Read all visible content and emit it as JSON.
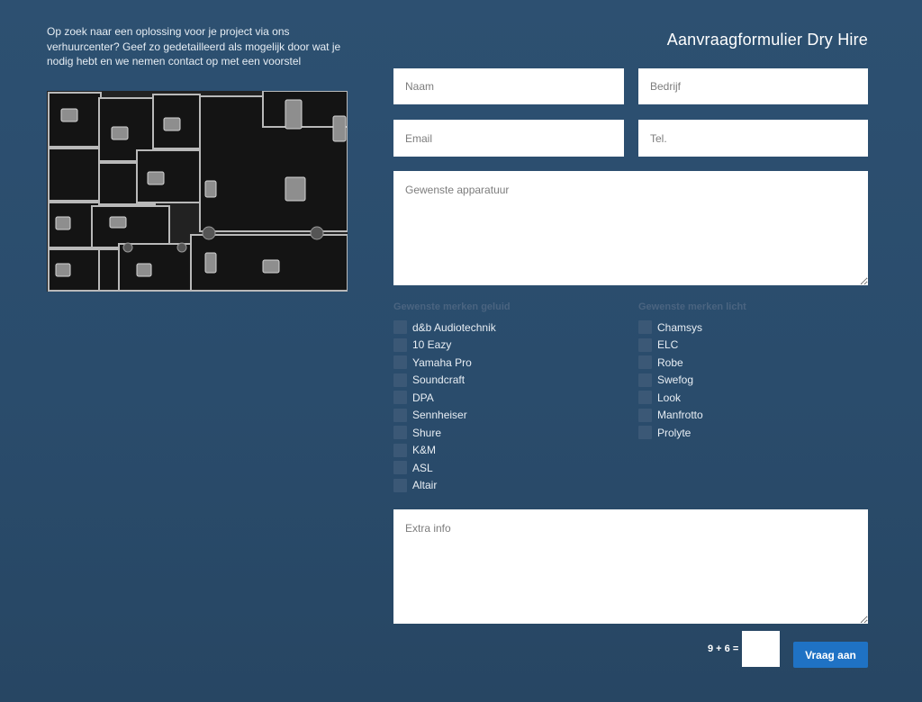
{
  "intro": {
    "text": "Op zoek naar een oplossing voor je project via ons verhuurcenter? Geef zo gedetailleerd als mogelijk door wat je nodig hebt en we nemen contact op met een voorstel"
  },
  "form": {
    "title": "Aanvraagformulier Dry Hire",
    "fields": {
      "naam": {
        "placeholder": "Naam",
        "value": ""
      },
      "bedrijf": {
        "placeholder": "Bedrijf",
        "value": ""
      },
      "email": {
        "placeholder": "Email",
        "value": ""
      },
      "tel": {
        "placeholder": "Tel.",
        "value": ""
      },
      "apparatuur": {
        "placeholder": "Gewenste apparatuur",
        "value": ""
      },
      "extra": {
        "placeholder": "Extra info",
        "value": ""
      }
    },
    "sound": {
      "title": "Gewenste merken geluid",
      "items": [
        "d&b Audiotechnik",
        "10 Eazy",
        "Yamaha Pro",
        "Soundcraft",
        "DPA",
        "Sennheiser",
        "Shure",
        "K&M",
        "ASL",
        "Altair"
      ]
    },
    "light": {
      "title": "Gewenste merken licht",
      "items": [
        "Chamsys",
        "ELC",
        "Robe",
        "Swefog",
        "Look",
        "Manfrotto",
        "Prolyte"
      ]
    },
    "captcha": {
      "question": "9 + 6 =",
      "value": ""
    },
    "submit_label": "Vraag aan"
  }
}
